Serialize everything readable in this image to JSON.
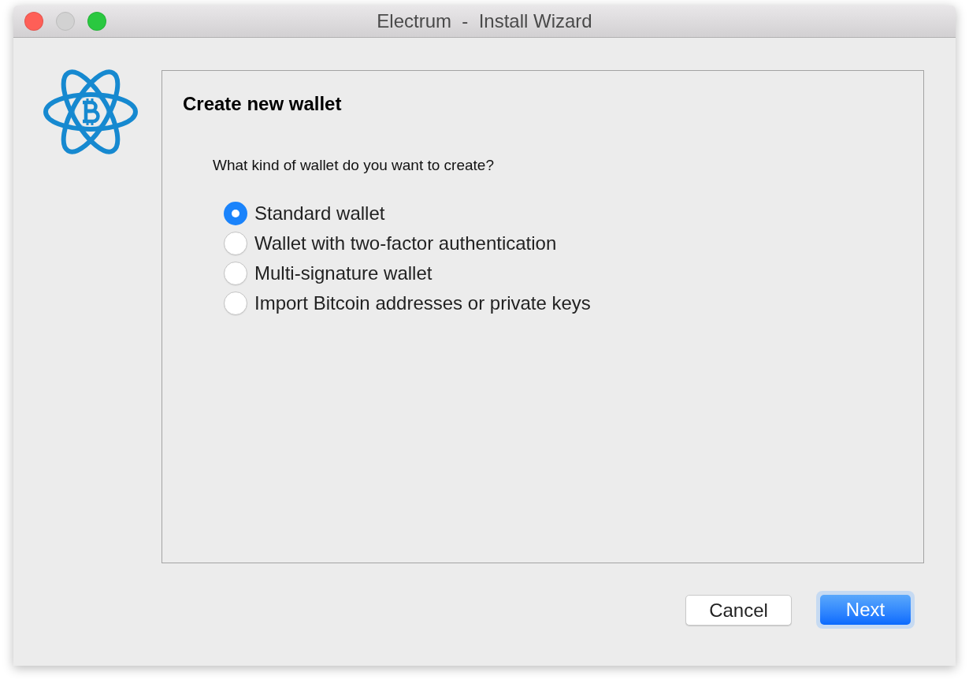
{
  "window": {
    "title": "Electrum  -  Install Wizard",
    "controls": [
      {
        "kind": "close",
        "disabled": false
      },
      {
        "kind": "minimize",
        "disabled": true
      },
      {
        "kind": "zoom",
        "disabled": false
      }
    ]
  },
  "page": {
    "heading": "Create new wallet",
    "question": "What kind of wallet do you want to create?",
    "options": [
      {
        "label": "Standard wallet",
        "selected": true
      },
      {
        "label": "Wallet with two-factor authentication",
        "selected": false
      },
      {
        "label": "Multi-signature wallet",
        "selected": false
      },
      {
        "label": "Import Bitcoin addresses or private keys",
        "selected": false
      }
    ]
  },
  "buttons": [
    {
      "label": "Cancel",
      "kind": "secondary"
    },
    {
      "label": "Next",
      "kind": "primary"
    }
  ]
}
